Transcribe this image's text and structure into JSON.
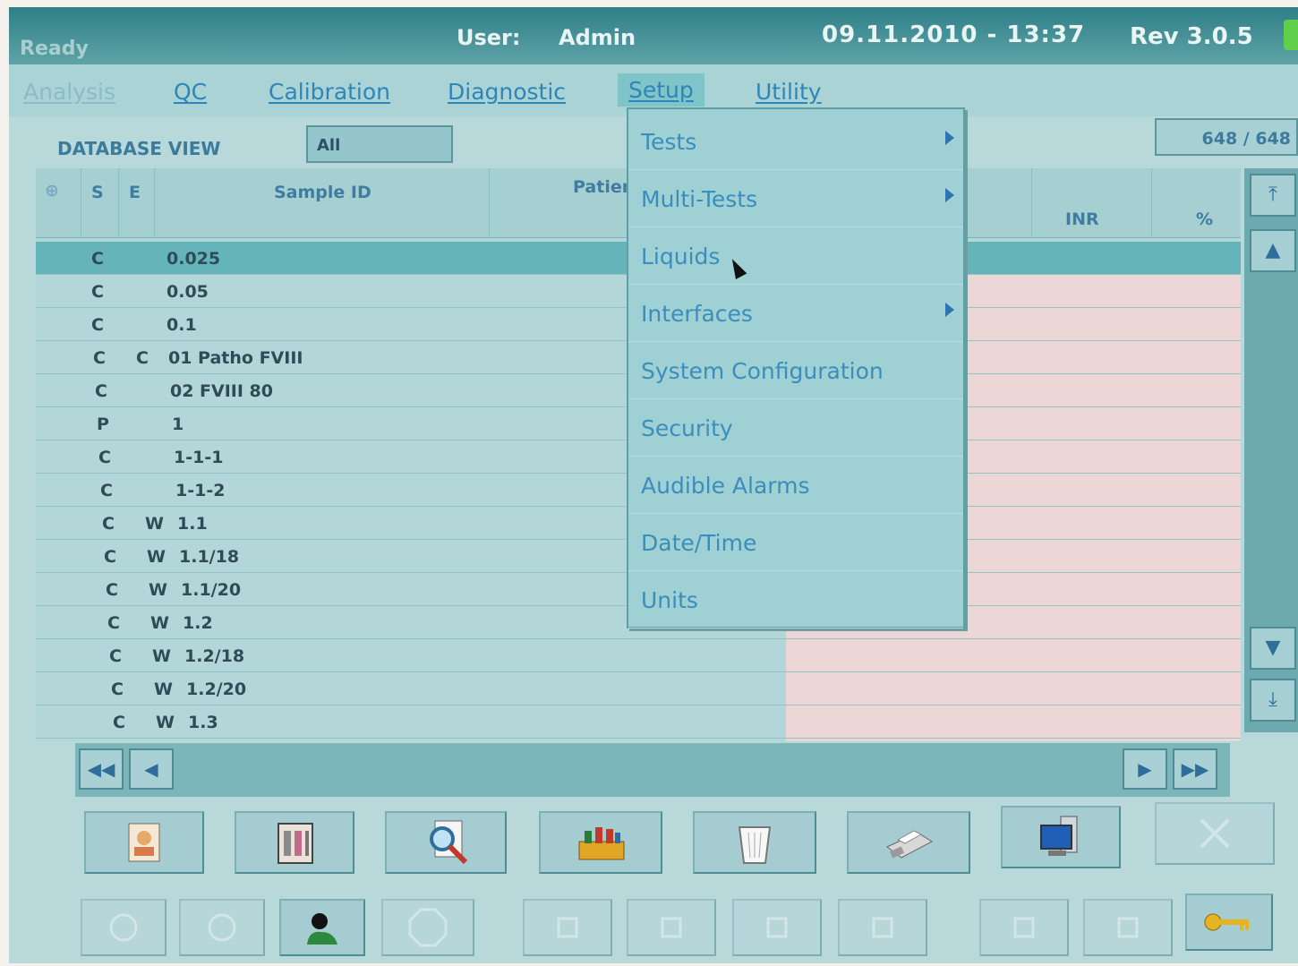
{
  "titlebar": {
    "status": "Ready",
    "user_label": "User:",
    "user_value": "Admin",
    "datetime": "09.11.2010 - 13:37",
    "revision": "Rev 3.0.5"
  },
  "menu": {
    "items": [
      {
        "label": "Analysis",
        "state": "disabled"
      },
      {
        "label": "QC",
        "state": "normal"
      },
      {
        "label": "Calibration",
        "state": "normal"
      },
      {
        "label": "Diagnostic",
        "state": "normal"
      },
      {
        "label": "Setup",
        "state": "active"
      },
      {
        "label": "Utility",
        "state": "normal"
      }
    ]
  },
  "database": {
    "label": "DATABASE VIEW",
    "filter_value": "All",
    "count": "648 / 648"
  },
  "table": {
    "headers": {
      "flag": "⊕",
      "s": "S",
      "e": "E",
      "sample_id": "Sample ID",
      "patient": "Patier",
      "inr": "INR",
      "percent": "%"
    },
    "rows": [
      {
        "s": "C",
        "e": "",
        "id": "0.025"
      },
      {
        "s": "C",
        "e": "",
        "id": "0.05"
      },
      {
        "s": "C",
        "e": "",
        "id": "0.1"
      },
      {
        "s": "C",
        "e": "C",
        "id": "01 Patho FVIII"
      },
      {
        "s": "C",
        "e": "",
        "id": "02 FVIII 80"
      },
      {
        "s": "P",
        "e": "",
        "id": "1"
      },
      {
        "s": "C",
        "e": "",
        "id": "1-1-1"
      },
      {
        "s": "C",
        "e": "",
        "id": "1-1-2"
      },
      {
        "s": "C",
        "e": "W",
        "id": "1.1"
      },
      {
        "s": "C",
        "e": "W",
        "id": "1.1/18"
      },
      {
        "s": "C",
        "e": "W",
        "id": "1.1/20"
      },
      {
        "s": "C",
        "e": "W",
        "id": "1.2"
      },
      {
        "s": "C",
        "e": "W",
        "id": "1.2/18"
      },
      {
        "s": "C",
        "e": "W",
        "id": "1.2/20"
      },
      {
        "s": "C",
        "e": "W",
        "id": "1.3"
      }
    ]
  },
  "setup_menu": {
    "items": [
      {
        "label": "Tests",
        "submenu": true
      },
      {
        "label": "Multi-Tests",
        "submenu": true
      },
      {
        "label": "Liquids",
        "submenu": false
      },
      {
        "label": "Interfaces",
        "submenu": true
      },
      {
        "label": "System Configuration",
        "submenu": false
      },
      {
        "label": "Security",
        "submenu": false
      },
      {
        "label": "Audible Alarms",
        "submenu": false
      },
      {
        "label": "Date/Time",
        "submenu": false
      },
      {
        "label": "Units",
        "submenu": false
      }
    ]
  },
  "scroll": {
    "top": "⤒",
    "up": "▲",
    "down": "▼",
    "bottom": "⤓"
  },
  "pager": {
    "first": "◀◀",
    "prev": "◀",
    "next": "▶",
    "last": "▶▶"
  },
  "icons": {
    "toolbar_top": [
      "patient-card-icon",
      "sample-rack-icon",
      "search-document-icon",
      "reagent-tray-icon",
      "waste-bin-icon",
      "printer-icon",
      "monitor-icon",
      "disabled-icon"
    ],
    "toolbar_bottom": [
      "disabled-icon",
      "disabled-icon",
      "user-icon",
      "stop-icon",
      "disabled-icon",
      "disabled-icon",
      "disabled-icon",
      "disabled-icon",
      "disabled-icon",
      "disabled-icon",
      "key-icon"
    ]
  },
  "colors": {
    "accent": "#2e86b8",
    "selected_row": "#64b4ba",
    "background": "#b9d8da"
  }
}
